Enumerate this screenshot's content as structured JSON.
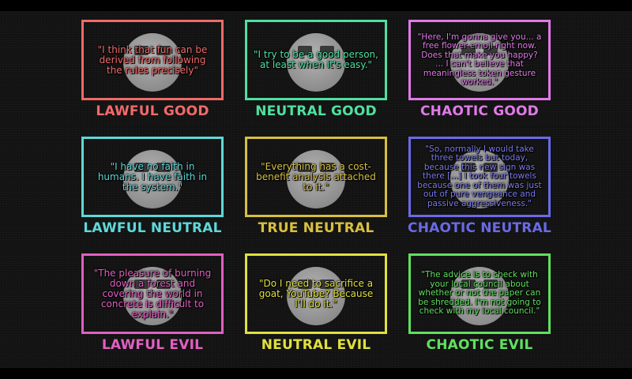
{
  "grid": [
    {
      "label": "LAWFUL GOOD",
      "quote": "\"I think that fun can be derived from following the rules precisely\"",
      "color": "#f06a6a"
    },
    {
      "label": "NEUTRAL GOOD",
      "quote": "\"I try to be a good person, at least when it's easy.\"",
      "color": "#4fe0a0"
    },
    {
      "label": "CHAOTIC GOOD",
      "quote": "\"Here, I'm gonna give you... a free flower emoji right now. Does that make you happy? ... I can't believe that meaningless token gesture worked.\"",
      "color": "#e07ae8"
    },
    {
      "label": "LAWFUL NEUTRAL",
      "quote": "\"I have no faith in humans. I have faith in the system.\"",
      "color": "#5fd8d8"
    },
    {
      "label": "TRUE NEUTRAL",
      "quote": "\"Everything has a cost-benefit analysis attached to it.\"",
      "color": "#d8c040"
    },
    {
      "label": "CHAOTIC NEUTRAL",
      "quote": "\"So, normally I would take three towels but today, because this new sign was there [...] I took four towels because one of them was just out of pure vengeance and passive aggressiveness.\"",
      "color": "#6a6ae8"
    },
    {
      "label": "LAWFUL EVIL",
      "quote": "\"The pleasure of burning down a forest and covering the world in concrete is difficult to explain.\"",
      "color": "#e060c0"
    },
    {
      "label": "NEUTRAL EVIL",
      "quote": "\"Do I need to sacrifice a goat, YouTube? Because I'll do it.\"",
      "color": "#e0e040"
    },
    {
      "label": "CHAOTIC EVIL",
      "quote": "\"The advice is to check with your local council about whether or not the paper can be shredded. I'm not going to check with my local council.\"",
      "color": "#60e060"
    }
  ]
}
